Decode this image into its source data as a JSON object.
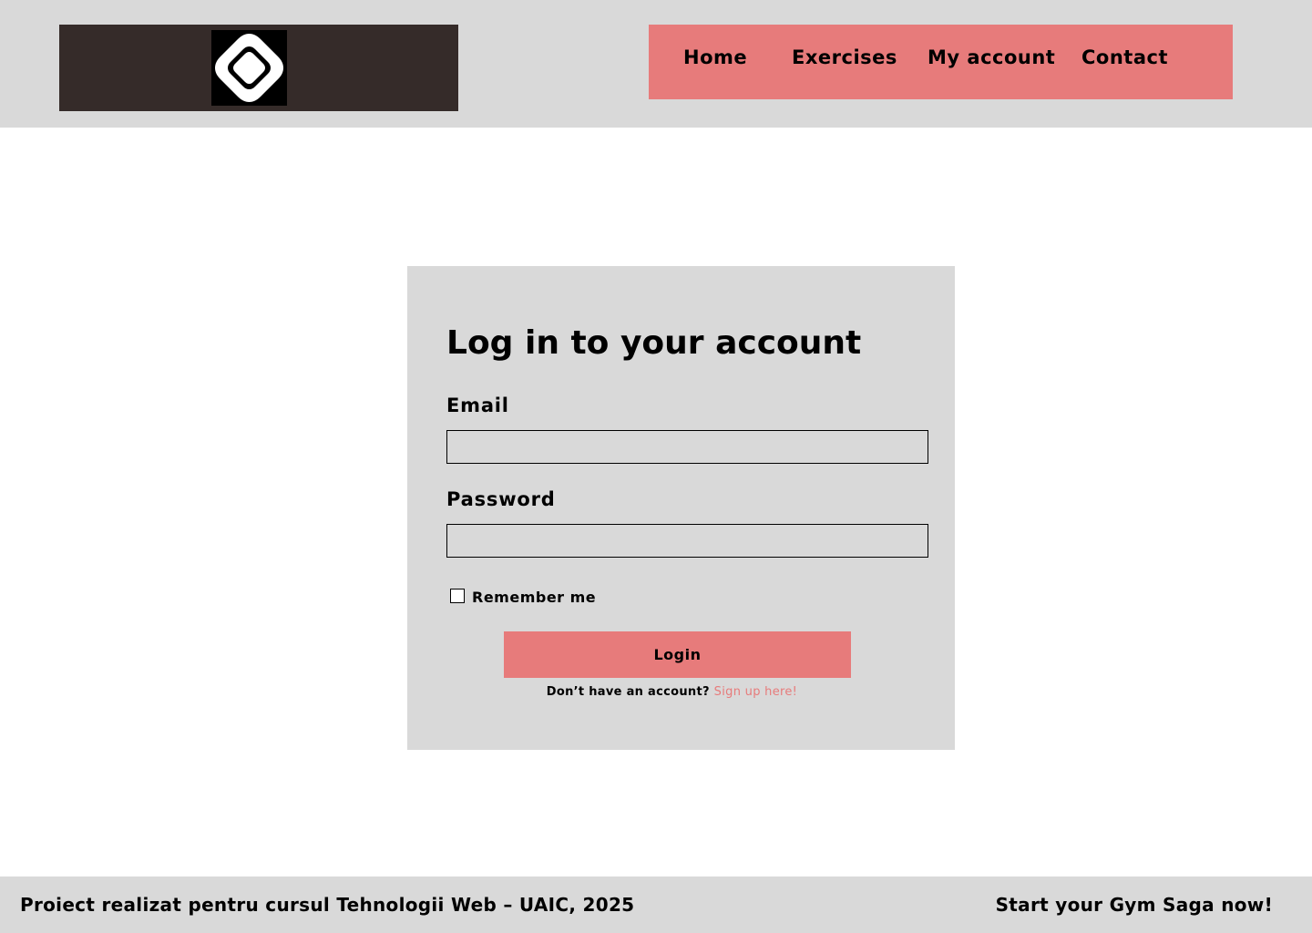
{
  "header": {
    "logo_alt": "logo",
    "nav": {
      "home": "Home",
      "exercises": "Exercises",
      "my_account": "My account",
      "contact": "Contact"
    }
  },
  "login": {
    "title": "Log in to your account",
    "email_label": "Email",
    "email_value": "",
    "password_label": "Password",
    "password_value": "",
    "remember_label": "Remember me",
    "remember_checked": false,
    "login_button": "Login",
    "signup_prompt": "Don’t have an account?",
    "signup_link": "Sign up here!"
  },
  "footer": {
    "left_text": "Proiect realizat pentru cursul Tehnologii Web – UAIC, 2025",
    "right_text": "Start your Gym Saga now!"
  },
  "colors": {
    "accent": "#e77b7b",
    "panel": "#d9d9d9",
    "logo_bg": "#352b29"
  }
}
